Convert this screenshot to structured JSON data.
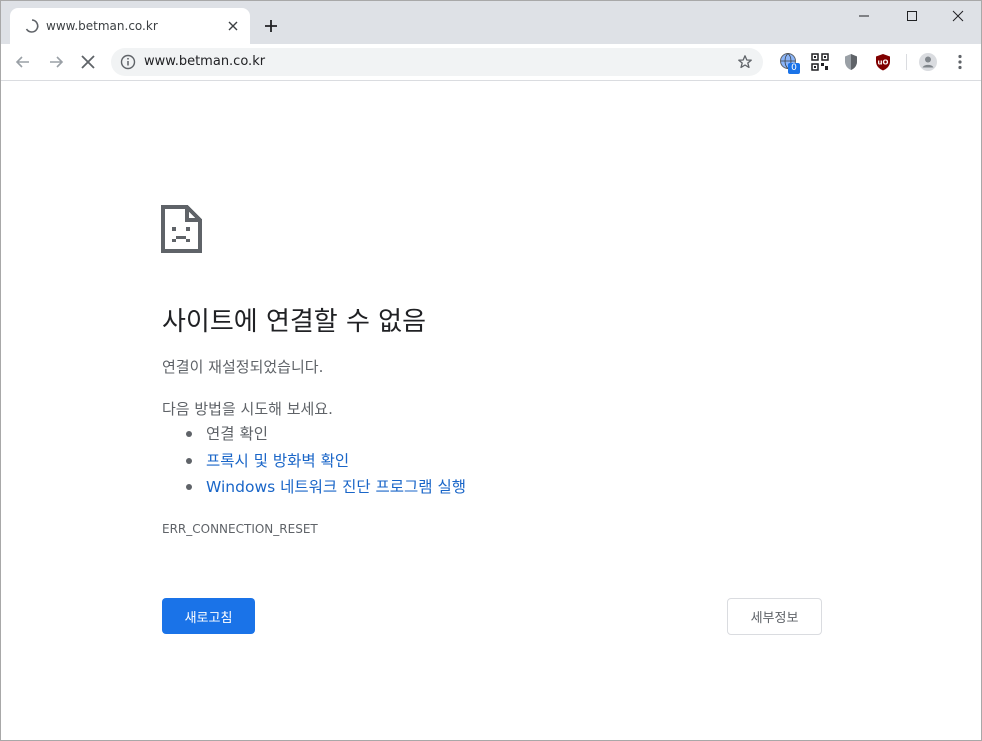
{
  "tab": {
    "title": "www.betman.co.kr",
    "loading_icon": "spinner-icon",
    "close_icon": "close-icon"
  },
  "new_tab_icon": "plus-icon",
  "window_controls": [
    "minimize-icon",
    "maximize-icon",
    "close-icon"
  ],
  "toolbar": {
    "back_icon": "arrow-left-icon",
    "forward_icon": "arrow-right-icon",
    "stop_icon": "stop-x-icon",
    "url": "www.betman.co.kr",
    "info_icon": "info-icon",
    "bookmark_icon": "star-icon",
    "extensions": [
      {
        "icon": "globe-extension-icon",
        "badge": "0"
      },
      {
        "icon": "qr-code-icon"
      },
      {
        "icon": "shield-extension-icon"
      },
      {
        "icon": "ublock-icon"
      }
    ],
    "profile_icon": "avatar-icon",
    "menu_icon": "more-vertical-icon"
  },
  "error": {
    "icon": "sad-document-icon",
    "title": "사이트에 연결할 수 없음",
    "description": "연결이 재설정되었습니다.",
    "try_heading": "다음 방법을 시도해 보세요.",
    "suggestions": [
      {
        "text": "연결 확인",
        "link": false
      },
      {
        "text": "프록시 및 방화벽 확인",
        "link": true
      },
      {
        "text": "Windows 네트워크 진단 프로그램 실행",
        "link": true
      }
    ],
    "code": "ERR_CONNECTION_RESET",
    "reload_label": "새로고침",
    "details_label": "세부정보"
  },
  "colors": {
    "accent": "#1a73e8",
    "link": "#1a66c8",
    "text_secondary": "#5f6368",
    "tabstrip": "#dee1e6"
  }
}
